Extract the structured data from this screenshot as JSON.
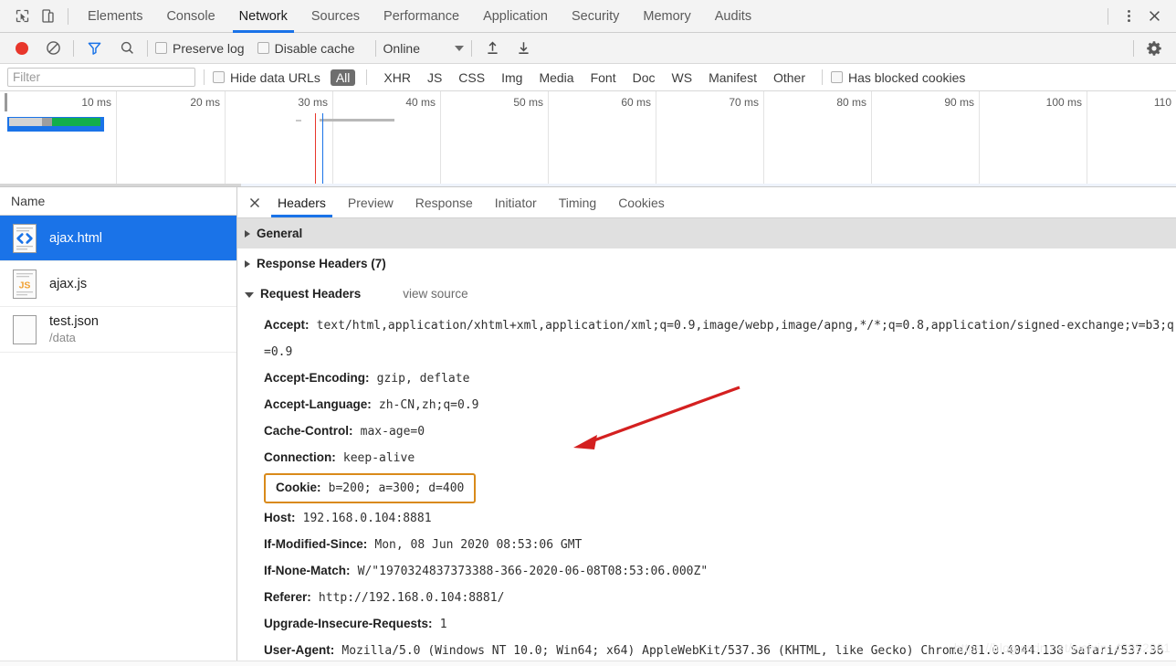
{
  "devtools": {
    "top_tabs": [
      {
        "label": "Elements",
        "active": false
      },
      {
        "label": "Console",
        "active": false
      },
      {
        "label": "Network",
        "active": true
      },
      {
        "label": "Sources",
        "active": false
      },
      {
        "label": "Performance",
        "active": false
      },
      {
        "label": "Application",
        "active": false
      },
      {
        "label": "Security",
        "active": false
      },
      {
        "label": "Memory",
        "active": false
      },
      {
        "label": "Audits",
        "active": false
      }
    ],
    "icons": {
      "inspect": "inspect-element-icon",
      "device": "device-toolbar-icon",
      "more": "more-options-icon",
      "close": "close-devtools-icon",
      "settings": "gear-icon"
    }
  },
  "toolbar": {
    "record_title": "record-button",
    "clear_title": "clear-button",
    "filter_title": "filter-button",
    "search_title": "search-button",
    "preserve_log": "Preserve log",
    "disable_cache": "Disable cache",
    "throttling": "Online",
    "import_title": "import-har-button",
    "export_title": "export-har-button"
  },
  "filterbar": {
    "placeholder": "Filter",
    "value": "",
    "hide_data_urls": "Hide data URLs",
    "types": [
      {
        "label": "All",
        "active": true
      },
      {
        "label": "XHR",
        "active": false
      },
      {
        "label": "JS",
        "active": false
      },
      {
        "label": "CSS",
        "active": false
      },
      {
        "label": "Img",
        "active": false
      },
      {
        "label": "Media",
        "active": false
      },
      {
        "label": "Font",
        "active": false
      },
      {
        "label": "Doc",
        "active": false
      },
      {
        "label": "WS",
        "active": false
      },
      {
        "label": "Manifest",
        "active": false
      },
      {
        "label": "Other",
        "active": false
      }
    ],
    "has_blocked_cookies": "Has blocked cookies"
  },
  "overview": {
    "ticks": [
      "10 ms",
      "20 ms",
      "30 ms",
      "40 ms",
      "50 ms",
      "60 ms",
      "70 ms",
      "80 ms",
      "90 ms",
      "100 ms",
      "110"
    ],
    "colors": {
      "request_bar": "#1a73e8",
      "waiting": "#c8c8c8",
      "download": "#13ae4b",
      "dom_content_loaded": "#1a73e8",
      "load_event": "#e8362b"
    }
  },
  "requests": {
    "column_name": "Name",
    "rows": [
      {
        "name": "ajax.html",
        "path": "",
        "icon": "html-document-icon",
        "selected": true
      },
      {
        "name": "ajax.js",
        "path": "",
        "icon": "javascript-file-icon",
        "selected": false
      },
      {
        "name": "test.json",
        "path": "/data",
        "icon": "generic-file-icon",
        "selected": false
      }
    ]
  },
  "detail": {
    "tabs": [
      {
        "label": "Headers",
        "active": true
      },
      {
        "label": "Preview",
        "active": false
      },
      {
        "label": "Response",
        "active": false
      },
      {
        "label": "Initiator",
        "active": false
      },
      {
        "label": "Timing",
        "active": false
      },
      {
        "label": "Cookies",
        "active": false
      }
    ],
    "sections": {
      "general": "General",
      "response_headers": "Response Headers (7)",
      "request_headers": "Request Headers",
      "view_source": "view source"
    },
    "request_headers": [
      {
        "key": "Accept:",
        "value": "text/html,application/xhtml+xml,application/xml;q=0.9,image/webp,image/apng,*/*;q=0.8,application/signed-exchange;v=b3;q=0.9",
        "highlighted": false
      },
      {
        "key": "Accept-Encoding:",
        "value": "gzip, deflate",
        "highlighted": false
      },
      {
        "key": "Accept-Language:",
        "value": "zh-CN,zh;q=0.9",
        "highlighted": false
      },
      {
        "key": "Cache-Control:",
        "value": "max-age=0",
        "highlighted": false
      },
      {
        "key": "Connection:",
        "value": "keep-alive",
        "highlighted": false
      },
      {
        "key": "Cookie:",
        "value": "b=200; a=300; d=400",
        "highlighted": true
      },
      {
        "key": "Host:",
        "value": "192.168.0.104:8881",
        "highlighted": false
      },
      {
        "key": "If-Modified-Since:",
        "value": "Mon, 08 Jun 2020 08:53:06 GMT",
        "highlighted": false
      },
      {
        "key": "If-None-Match:",
        "value": "W/\"1970324837373388-366-2020-06-08T08:53:06.000Z\"",
        "highlighted": false
      },
      {
        "key": "Referer:",
        "value": "http://192.168.0.104:8881/",
        "highlighted": false
      },
      {
        "key": "Upgrade-Insecure-Requests:",
        "value": "1",
        "highlighted": false
      },
      {
        "key": "User-Agent:",
        "value": "Mozilla/5.0 (Windows NT 10.0; Win64; x64) AppleWebKit/537.36 (KHTML, like Gecko) Chrome/81.0.4044.138 Safari/537.36",
        "highlighted": false
      }
    ]
  },
  "annotations": {
    "arrow_color": "#d42020",
    "highlight_box_color": "#d98a1a",
    "watermark": "https://blog.csdn.net/weixin_43352901"
  }
}
